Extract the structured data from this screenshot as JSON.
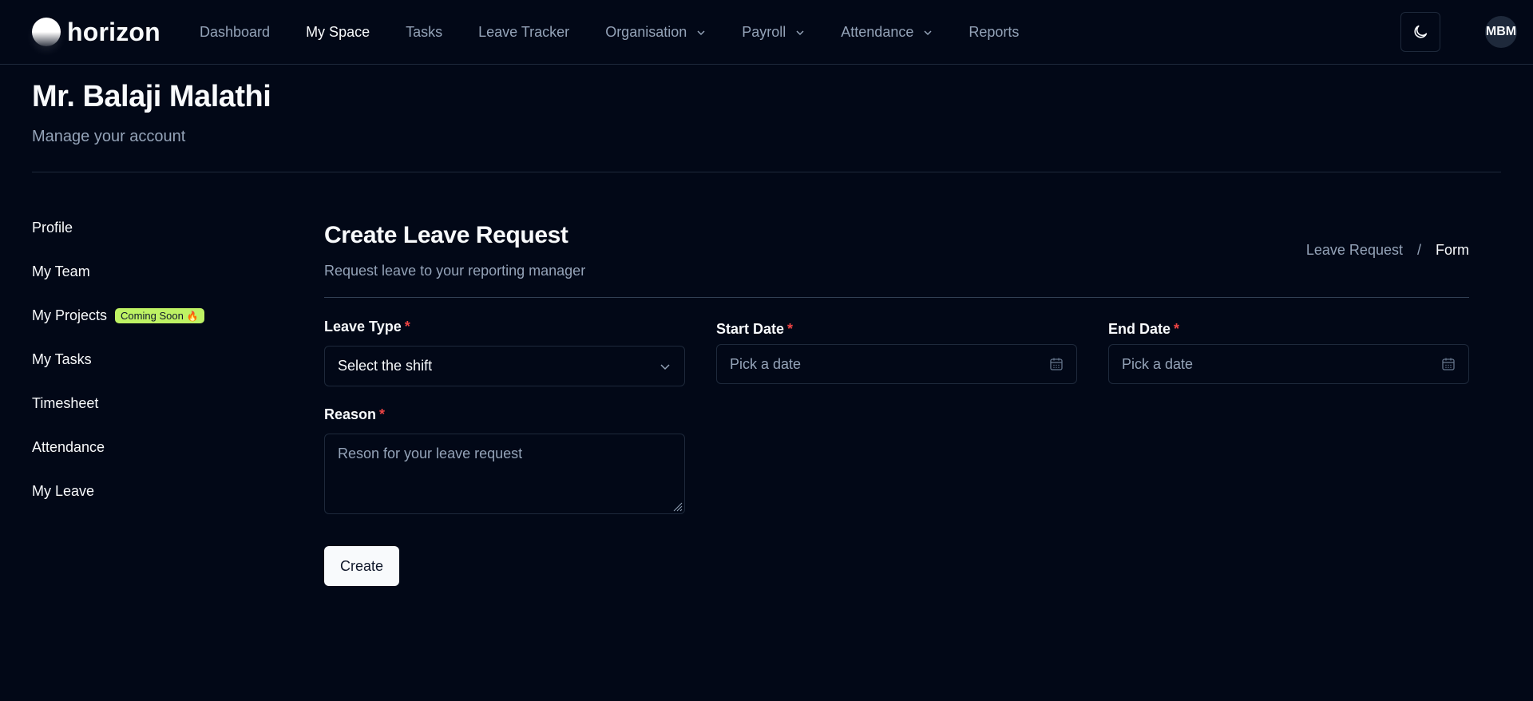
{
  "app": {
    "logo_text": "horizon"
  },
  "nav": {
    "items": [
      {
        "label": "Dashboard"
      },
      {
        "label": "My Space"
      },
      {
        "label": "Tasks"
      },
      {
        "label": "Leave Tracker"
      },
      {
        "label": "Organisation"
      },
      {
        "label": "Payroll"
      },
      {
        "label": "Attendance"
      },
      {
        "label": "Reports"
      }
    ],
    "active": "My Space"
  },
  "user": {
    "initials": "MBM"
  },
  "header": {
    "title": "Mr. Balaji Malathi",
    "subtitle": "Manage your account"
  },
  "sidebar": {
    "items": [
      {
        "label": "Profile"
      },
      {
        "label": "My Team"
      },
      {
        "label": "My Projects",
        "badge": "Coming Soon"
      },
      {
        "label": "My Tasks"
      },
      {
        "label": "Timesheet"
      },
      {
        "label": "Attendance"
      },
      {
        "label": "My Leave"
      }
    ]
  },
  "form": {
    "title": "Create Leave Request",
    "subtitle": "Request leave to your reporting manager",
    "breadcrumb": {
      "parent": "Leave Request",
      "separator": "/",
      "current": "Form"
    },
    "leave_type": {
      "label": "Leave Type",
      "value": "Select the shift"
    },
    "start_date": {
      "label": "Start Date",
      "placeholder": "Pick a date"
    },
    "end_date": {
      "label": "End Date",
      "placeholder": "Pick a date"
    },
    "reason": {
      "label": "Reason",
      "placeholder": "Reson for your leave request"
    },
    "required_mark": "*",
    "submit_label": "Create"
  },
  "colors": {
    "background": "#020817",
    "border": "#1e293b",
    "muted_text": "#94a3b8",
    "required": "#ef4444",
    "badge_bg": "#bef264"
  }
}
